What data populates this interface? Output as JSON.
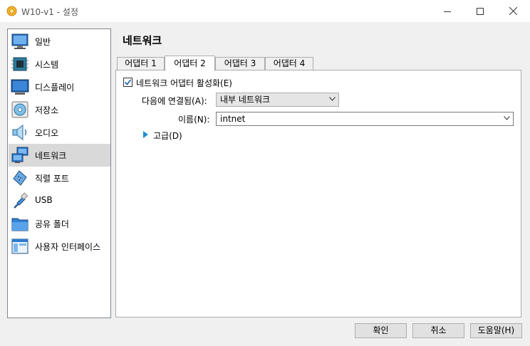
{
  "window": {
    "title": "W10-v1 - 설정"
  },
  "sidebar": {
    "items": [
      {
        "label": "일반",
        "icon": "general-icon"
      },
      {
        "label": "시스템",
        "icon": "system-icon"
      },
      {
        "label": "디스플레이",
        "icon": "display-icon"
      },
      {
        "label": "저장소",
        "icon": "storage-icon"
      },
      {
        "label": "오디오",
        "icon": "audio-icon"
      },
      {
        "label": "네트워크",
        "icon": "network-icon",
        "selected": true
      },
      {
        "label": "직렬 포트",
        "icon": "serial-port-icon"
      },
      {
        "label": "USB",
        "icon": "usb-icon"
      },
      {
        "label": "공유 폴더",
        "icon": "shared-folder-icon"
      },
      {
        "label": "사용자 인터페이스",
        "icon": "user-interface-icon"
      }
    ]
  },
  "main": {
    "title": "네트워크",
    "tabs": [
      {
        "label": "어댑터 1"
      },
      {
        "label": "어댑터 2",
        "active": true
      },
      {
        "label": "어댑터 3"
      },
      {
        "label": "어댑터 4"
      }
    ],
    "enable_adapter": {
      "label": "네트워크 어댑터 활성화(E)",
      "checked": true
    },
    "attached_to": {
      "label": "다음에 연결됨(A):",
      "value": "내부 네트워크"
    },
    "name": {
      "label": "이름(N):",
      "value": "intnet"
    },
    "advanced": {
      "label": "고급(D)"
    }
  },
  "buttons": {
    "ok": "확인",
    "cancel": "취소",
    "help": "도움말(H)"
  },
  "colors": {
    "accent": "#1e8fd6",
    "selection": "#d9d9d9",
    "checkmark": "#1a5fb4"
  }
}
